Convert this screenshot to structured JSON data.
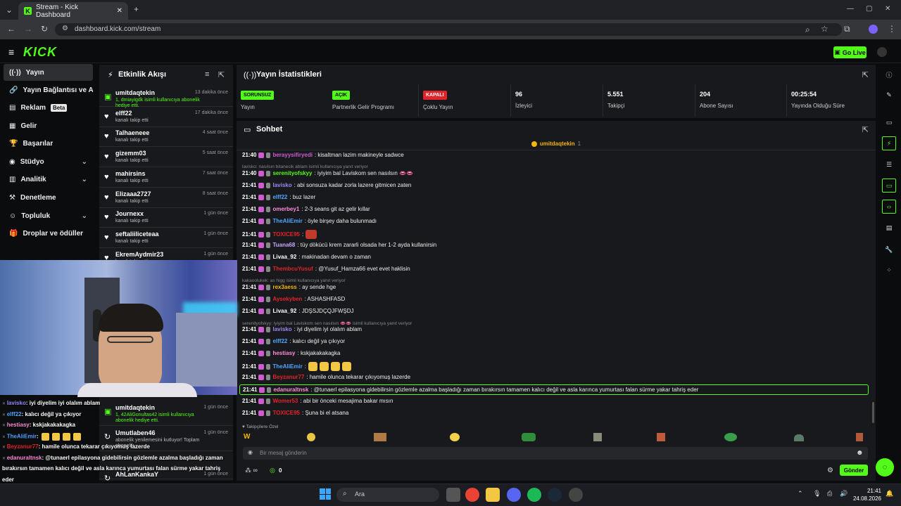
{
  "browser": {
    "tab_title": "Stream - Kick Dashboard",
    "url": "dashboard.kick.com/stream"
  },
  "header": {
    "logo": "KICK",
    "go_live": "Go Live"
  },
  "nav": {
    "items": [
      {
        "label": "Yayın"
      },
      {
        "label": "Yayın Bağlantısı ve Anahtarı"
      },
      {
        "label": "Reklam"
      },
      {
        "label": "Gelir"
      },
      {
        "label": "Başarılar"
      },
      {
        "label": "Stüdyo"
      },
      {
        "label": "Analitik"
      },
      {
        "label": "Denetleme"
      },
      {
        "label": "Topluluk"
      },
      {
        "label": "Droplar ve ödüller"
      }
    ],
    "beta": "Beta"
  },
  "activity": {
    "title": "Etkinlik Akışı",
    "items": [
      {
        "name": "umitdaqtekin",
        "sub": "1, dmiayigdk isimli kullanıcıya abonelik hediye etti.",
        "time": "13 dakika önce"
      },
      {
        "name": "elff22",
        "sub": "kanalı takip etti",
        "time": "17 dakika önce"
      },
      {
        "name": "Talhaeneee",
        "sub": "kanalı takip etti",
        "time": "4 saat önce"
      },
      {
        "name": "gizemm03",
        "sub": "kanalı takip etti",
        "time": "5 saat önce"
      },
      {
        "name": "mahirsins",
        "sub": "kanalı takip etti",
        "time": "7 saat önce"
      },
      {
        "name": "Elizaaa2727",
        "sub": "kanalı takip etti",
        "time": "8 saat önce"
      },
      {
        "name": "Journexx",
        "sub": "kanalı takip etti",
        "time": "1 gün önce"
      },
      {
        "name": "seftaliiliceteaa",
        "sub": "kanalı takip etti",
        "time": "1 gün önce"
      },
      {
        "name": "EkremAydmir23",
        "sub": "kanalı takip etti",
        "time": "1 gün önce"
      }
    ],
    "lower_items": [
      {
        "name": "umitdaqtekin",
        "sub": "1, 42AliGonultas42 isimli kullanıcıya abonelik hediye etti.",
        "time": "1 gün önce"
      },
      {
        "name": "Umutlaben46",
        "sub": "abonelik yenilemesini kutluyor! Toplam abonelik",
        "time": "1 gün önce"
      },
      {
        "name": "AhLanKankaY",
        "sub": "",
        "time": "1 gün önce"
      }
    ]
  },
  "stats": {
    "title": "Yayın İstatistikleri",
    "cells": [
      {
        "badge": "SORUNSUZ",
        "label": "Yayın"
      },
      {
        "badge": "AÇIK",
        "label": "Partnerlik Gelir Programı"
      },
      {
        "badge": "KAPALI",
        "label": "Çoklu Yayın"
      },
      {
        "value": "96",
        "label": "İzleyici"
      },
      {
        "value": "5.551",
        "label": "Takipçi"
      },
      {
        "value": "204",
        "label": "Abone Sayısı"
      },
      {
        "value": "00:25:54",
        "label": "Yayında Olduğu Süre"
      }
    ],
    "colors": {
      "green": "#53fc18",
      "red": "#e0242a"
    }
  },
  "chat": {
    "title": "Sohbet",
    "pinned_user": "umitdaqtekin",
    "pinned_count": "1",
    "messages": [
      {
        "time": "21:40",
        "user": "berayysifiryedi",
        "color": "#d05bd1",
        "text": ": kisaltman lazim makineyle sadwce"
      },
      {
        "reply": "lavisko: nasılsın bitanecik ablam isimli kullanıcıya yanıt veriyor"
      },
      {
        "time": "21:40",
        "user": "serenityofskyy",
        "color": "#53fc18",
        "text": ": iyiyim bal Laviskom sen nasılsın 👄👄"
      },
      {
        "time": "21:41",
        "user": "lavisko",
        "color": "#9b87f5",
        "text": ": abi sonsuza kadar zorla lazere gitmicen zaten"
      },
      {
        "time": "21:41",
        "user": "elff22",
        "color": "#4fa6ff",
        "text": ": buz lazer"
      },
      {
        "time": "21:41",
        "user": "omerbey1",
        "color": "#ff8cd9",
        "text": ": 2-3 seans git az gelir kıllar"
      },
      {
        "time": "21:41",
        "user": "TheAliEmir",
        "color": "#4fa6ff",
        "text": ": öyle birşey daha bulunmadı"
      },
      {
        "time": "21:41",
        "user": "TOXICE95",
        "color": "#e0242a",
        "text": ":"
      },
      {
        "time": "21:41",
        "user": "Tuana68",
        "color": "#c7a6ff",
        "text": ": tüy dökücü krem zararli olsada her 1-2 ayda kullanirsin"
      },
      {
        "time": "21:41",
        "user": "Livaa_92",
        "color": "#ffffff",
        "text": ": makinadan devam o zaman"
      },
      {
        "time": "21:41",
        "user": "ThembcuYusuf",
        "color": "#e0242a",
        "text": ": @Yusuf_Hamza66 evet evet haklisin"
      },
      {
        "reply": "kakaoolukek: as higg isimli kullanıcıya yanıt veriyor"
      },
      {
        "time": "21:41",
        "user": "rex3aess",
        "color": "#f5b50a",
        "text": ": ay sende hge"
      },
      {
        "time": "21:41",
        "user": "Aysekyben",
        "color": "#e0242a",
        "text": ": ASHASHFASD"
      },
      {
        "time": "21:41",
        "user": "Livaa_92",
        "color": "#ffffff",
        "text": ": JDŞSJDÇQJFWŞDJ"
      },
      {
        "reply": "serenityofskyy: iyiyim bal Laviskom sen nasılsın 👄👄 isimli kullanıcıya yanıt veriyor"
      },
      {
        "time": "21:41",
        "user": "lavisko",
        "color": "#9b87f5",
        "text": ": iyi diyelim iyi olalım ablam"
      },
      {
        "time": "21:41",
        "user": "elff22",
        "color": "#4fa6ff",
        "text": ": kalıcı değil ya çıkıyor"
      },
      {
        "time": "21:41",
        "user": "hestiasy",
        "color": "#ff8cd9",
        "text": ": kskjakakakagka"
      },
      {
        "time": "21:41",
        "user": "TheAliEmir",
        "color": "#4fa6ff",
        "text": ":"
      },
      {
        "time": "21:41",
        "user": "Beyzanur77",
        "color": "#e0242a",
        "text": ": hamile olunca tekarar çıkıyomuş lazerde"
      },
      {
        "time": "21:41",
        "user": "edanuraltnsk",
        "color": "#ff8cd9",
        "text": ": @tunaerl epilasyona gidebilirsin gözlemle azalma başladığı zaman bırakırsın tamamen kalıcı değil ve asla karınca yumurtası falan sürme yakar tahriş eder",
        "highlight": true
      },
      {
        "time": "21:41",
        "user": "Womer53",
        "color": "#e0242a",
        "text": ": abi bir önceki mesajima bakar mısın"
      },
      {
        "time": "21:41",
        "user": "TOXICE95",
        "color": "#e0242a",
        "text": ": Şuna bi el atsana"
      }
    ],
    "emote_row_label": "Takipçilere Özel",
    "input_placeholder": "Bir mesaj gönderin",
    "send": "Gönder",
    "viewer_count": "0"
  },
  "overlay": [
    {
      "user": "lavisko",
      "color": "#9b87f5",
      "text": ": iyi diyelim iyi olalım ablam"
    },
    {
      "user": "elff22",
      "color": "#4fa6ff",
      "text": ": kalıcı değil ya çıkıyor"
    },
    {
      "user": "hestiasy",
      "color": "#ff8cd9",
      "text": ": kskjakakakagka"
    },
    {
      "user": "TheAliEmir",
      "color": "#4fa6ff",
      "text": ":"
    },
    {
      "user": "Beyzanur77",
      "color": "#e0242a",
      "text": ": hamile olunca tekarar çıkıyomuş lazerde"
    },
    {
      "user": "edanuraltnsk",
      "color": "#ff8cd9",
      "text": ": @tunaerl epilasyona gidebilirsin gözlemle azalma başladığı zaman"
    },
    {
      "text2": "bırakırsın tamamen kalıcı değil ve asla karınca yumurtası falan sürme yakar tahriş"
    },
    {
      "text2": "eder"
    },
    {
      "user": "Womer53",
      "color": "#e0242a",
      "text": ": abi bir önceki mesajima bakar mısın"
    },
    {
      "user": "TOXICE95",
      "color": "#e0242a",
      "text": ": Şuna bi el atsana"
    }
  ],
  "taskbar": {
    "search": "Ara",
    "time": "21:41",
    "date": "24.08.2026"
  }
}
